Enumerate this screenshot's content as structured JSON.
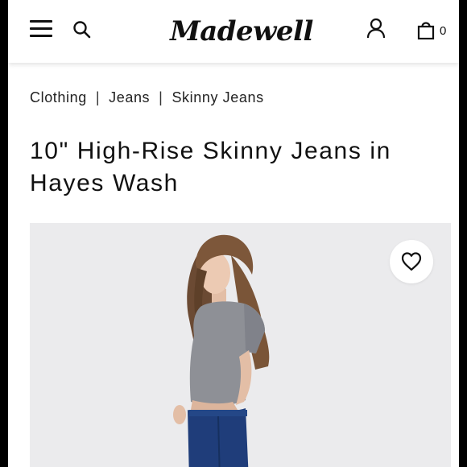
{
  "header": {
    "logo_text": "Madewell",
    "bag_count": "0",
    "icons": [
      "menu-icon",
      "search-icon",
      "account-icon",
      "bag-icon"
    ]
  },
  "breadcrumb": {
    "items": [
      "Clothing",
      "Jeans",
      "Skinny Jeans"
    ],
    "separator": "|"
  },
  "product": {
    "title": "10\" High-Rise Skinny Jeans in Hayes Wash",
    "image_alt": "Model wearing gray tee and dark blue skinny jeans",
    "wishlist_icon": "heart-icon"
  },
  "colors": {
    "text": "#111111",
    "image_background": "#ebebed",
    "jeans": "#1f3d7a",
    "tee": "#8e9096"
  }
}
